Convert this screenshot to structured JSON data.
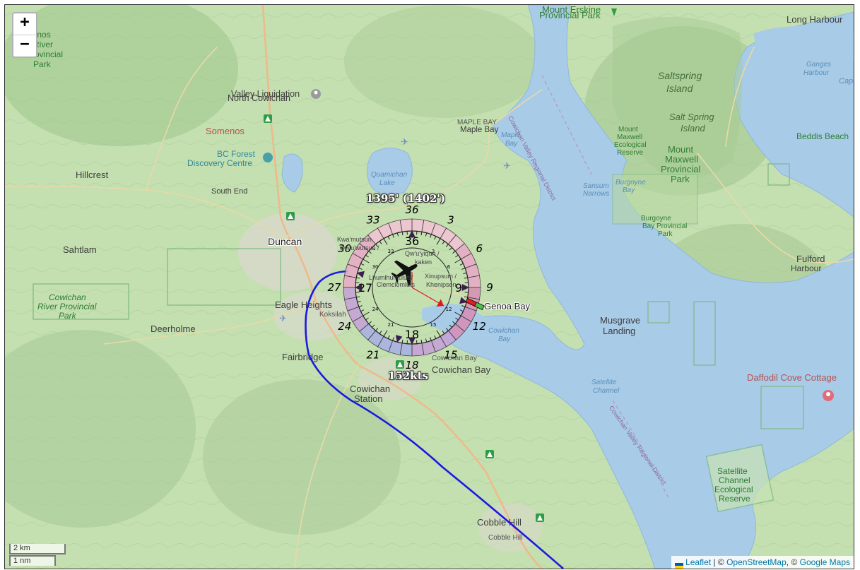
{
  "map": {
    "labels": {
      "mount_erskine": "Mount Erskine",
      "mount_erskine_park": "Provincial Park",
      "long_harbour": "Long Harbour",
      "somenos_top": "Somenos",
      "river": "River",
      "provincial": "Provincial",
      "park": "Park",
      "valley_liquidation": "Valley Liquidation",
      "north_cowichan": "North Cowichan",
      "somenos": "Somenos",
      "bc_forest": "BC Forest",
      "discovery_centre": "Discovery Centre",
      "hillcrest": "Hillcrest",
      "south_end": "South End",
      "quamichan_lake": "Quamichan",
      "quamichan_lake2": "Lake",
      "maple_bay_caps": "MAPLE BAY",
      "maple_bay": "Maple Bay",
      "maple_bay_water": "Maple",
      "maple_bay_water2": "Bay",
      "saltspring": "Saltspring",
      "saltspring2": "Island",
      "salt_spring": "Salt Spring",
      "salt_spring2": "Island",
      "ganges": "Ganges",
      "ganges2": "Harbour",
      "beddis": "Beddis Beach",
      "mount_maxwell_eco": "Mount",
      "mount_maxwell_eco2": "Maxwell",
      "mount_maxwell_eco3": "Ecological",
      "mount_maxwell_eco4": "Reserve",
      "mount_maxwell": "Mount",
      "maxwell": "Maxwell",
      "maxwell_provincial": "Provincial",
      "maxwell_park": "Park",
      "sansum": "Sansum",
      "sansum2": "Narrows",
      "burgoyne_bay": "Burgoyne",
      "burgoyne_bay2": "Bay",
      "burgoyne_park": "Burgoyne",
      "burgoyne_park2": "Bay Provincial",
      "burgoyne_park3": "Park",
      "sahtlam": "Sahtlam",
      "duncan": "Duncan",
      "cowichan_river": "Cowichan",
      "cowichan_river2": "River Provincial",
      "cowichan_river3": "Park",
      "eagle_heights": "Eagle Heights",
      "koksilah": "Koksilah",
      "deerholme": "Deerholme",
      "fairbridge": "Fairbridge",
      "genoa_bay": "Genoa Bay",
      "cowichan_bay_small": "Cowichan Bay",
      "cowichan_bay": "Cowichan Bay",
      "cowichan_bay_water": "Cowichan",
      "cowichan_bay_water2": "Bay",
      "cowichan_station": "Cowichan",
      "cowichan_station2": "Station",
      "musgrave": "Musgrave",
      "musgrave2": "Landing",
      "daffodil": "Daffodil Cove Cottage",
      "satellite_channel": "Satellite",
      "satellite_channel2": "Channel",
      "satellite_eco": "Satellite",
      "satellite_eco2": "Channel",
      "satellite_eco3": "Ecological",
      "satellite_eco4": "Reserve",
      "fulford": "Fulford",
      "fulford2": "Harbour",
      "cobble_hill": "Cobble Hill",
      "cobble_hill_small": "Cobble Hill",
      "cvrd": "Cowichan Valley Regional District",
      "cvrd2": "Cowichan Valley Regional District",
      "capo": "Capo",
      "xinupsum": "Xinupsum /",
      "khenipsen": "Khenipsen",
      "lhumlhumuluts": "Lhumlhumuluts'",
      "clemclemluts": "Clemclemluts",
      "quwutsun": "Qw'u'wutsun /",
      "kwamutsun": "Kwa'mutsun",
      "qw_yiqun": "Qw'u'yiqun /",
      "kaken": "kaken"
    }
  },
  "controls": {
    "zoom_in": "+",
    "zoom_out": "−"
  },
  "scale": {
    "metric": "2 km",
    "imperial": "1 nm"
  },
  "attribution": {
    "leaflet": "Leaflet",
    "sep1": " | © ",
    "osm": "OpenStreetMap",
    "sep2": ", © ",
    "google": "Google Maps"
  },
  "instrument": {
    "altitude": "1395' (1402')",
    "speed": "152kts",
    "outer_ticks": [
      "36",
      "3",
      "6",
      "9",
      "12",
      "15",
      "18",
      "21",
      "24",
      "27",
      "30",
      "33"
    ],
    "mid_ticks": [
      "36",
      "9",
      "18",
      "27"
    ],
    "inner_ticks": [
      "33",
      "30",
      "3",
      "6",
      "12",
      "15",
      "21",
      "24"
    ],
    "heading_deg": 60,
    "wind_bearing_deg": 120
  },
  "colors": {
    "track": "#1a1adf",
    "water": "#a8cbe8",
    "land": "#c4dfb0",
    "forest": "#b0d49c",
    "park_border": "#7db883",
    "road": "#f3c7a0",
    "attribution_link": "#0078a8"
  }
}
